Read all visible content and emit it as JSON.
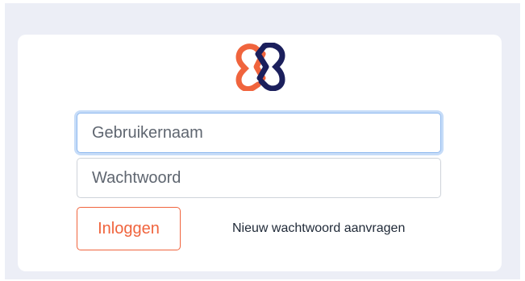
{
  "login": {
    "username_placeholder": "Gebruikernaam",
    "password_placeholder": "Wachtwoord",
    "login_label": "Inloggen",
    "reset_link_label": "Nieuw wachtwoord aanvragen"
  },
  "logo": {
    "icon": "brand-logo-icon",
    "colors": [
      "#f0643d",
      "#1b1f5c"
    ]
  },
  "colors": {
    "accent": "#f0643d",
    "focus_ring": "#8fb9ef",
    "page_background": "#eceef6"
  }
}
